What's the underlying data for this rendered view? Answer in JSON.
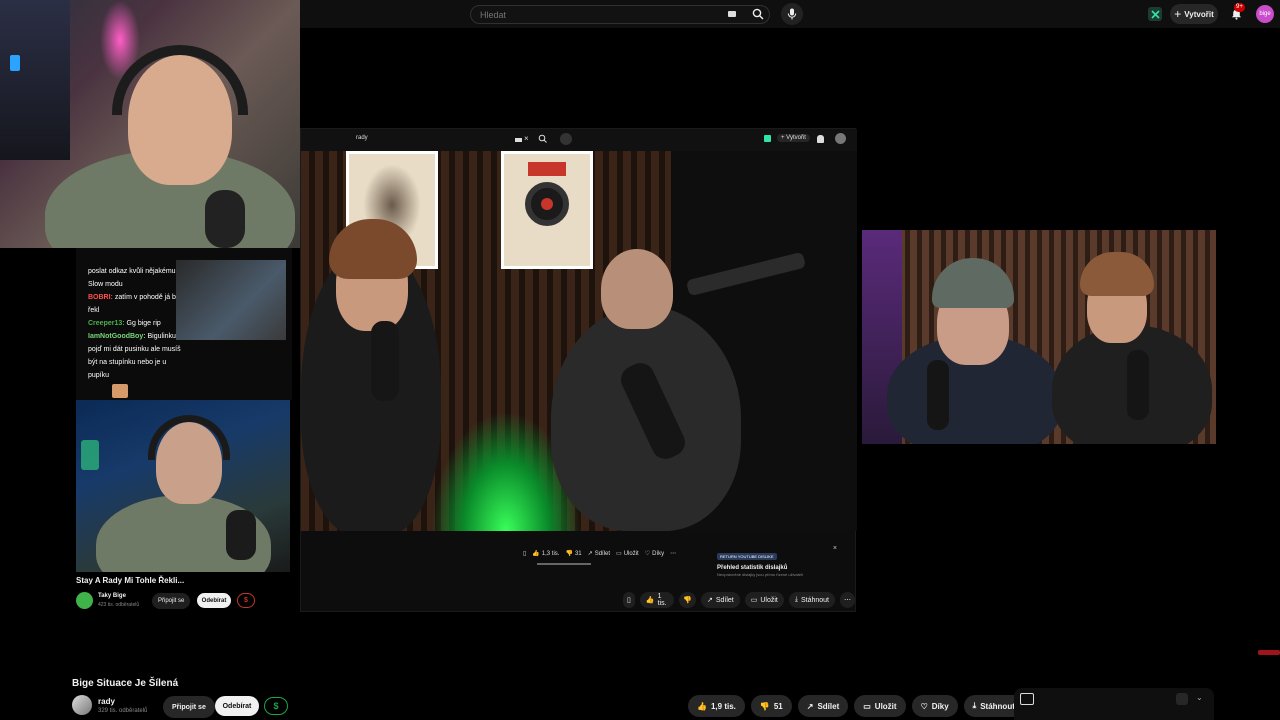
{
  "topbar": {
    "search_placeholder": "Hledat",
    "create_label": "Vytvořit",
    "notif_badge": "9+",
    "avatar_text": "bige"
  },
  "nested_topbar": {
    "search_value": "rady",
    "create_label": "Vytvořit"
  },
  "chat": {
    "lines": [
      {
        "name": "",
        "text": "poslat odkaz kvůli nějakému"
      },
      {
        "name": "",
        "text": "Slow modu"
      },
      {
        "name": "BOBRI:",
        "text": "zatím v pohodě já bych"
      },
      {
        "name": "",
        "text": "řekl"
      },
      {
        "name": "Creeper13:",
        "text": "Gg bige rip"
      },
      {
        "name": "IamNotGoodBoy:",
        "text": "Bigulinku"
      },
      {
        "name": "",
        "text": "pojď mi dát pusinku ale musíš"
      },
      {
        "name": "",
        "text": "být na stupínku nebo je u"
      },
      {
        "name": "",
        "text": "pupíku"
      }
    ],
    "colors": {
      "BOBRI:": "#ff4d4d",
      "Creeper13:": "#4caf50",
      "IamNotGoodBoy:": "#7bd67b"
    }
  },
  "nested_video": {
    "title": "Stay A Rady Mi Tohle Řekli...",
    "channel_name": "Taky Bige",
    "channel_subs": "423 tis. odběratelů",
    "join_label": "Připojit se",
    "subscribe_label": "Odebírat",
    "inner_actions": {
      "likes": "1,3 tis.",
      "dislikes": "31",
      "share": "Sdílet",
      "save": "Uložit",
      "thanks": "Díky"
    },
    "popup": {
      "badge": "RETURN YOUTUBE DISLIKE",
      "title": "Přehled statistik dislajků",
      "subtitle": "Neoprávněné dislajky jsou přímo řízené uživateli"
    },
    "actions": {
      "likes": "1 tis.",
      "share": "Sdílet",
      "save": "Uložit",
      "download": "Stáhnout"
    }
  },
  "main_video": {
    "title": "Bige Situace Je Šílená",
    "channel_name": "rady",
    "channel_subs": "329 tis. odběratelů",
    "join_label": "Připojit se",
    "subscribe_label": "Odebírat",
    "actions": {
      "likes": "1,9 tis.",
      "dislikes": "51",
      "share": "Sdílet",
      "save": "Uložit",
      "thanks": "Díky",
      "download": "Stáhnout"
    }
  },
  "colors": {
    "background": "#000000",
    "surface": "#272727",
    "subscribe_bg": "#f1f1f1",
    "supers_green": "#1ea446",
    "notif_red": "#cc0000"
  }
}
